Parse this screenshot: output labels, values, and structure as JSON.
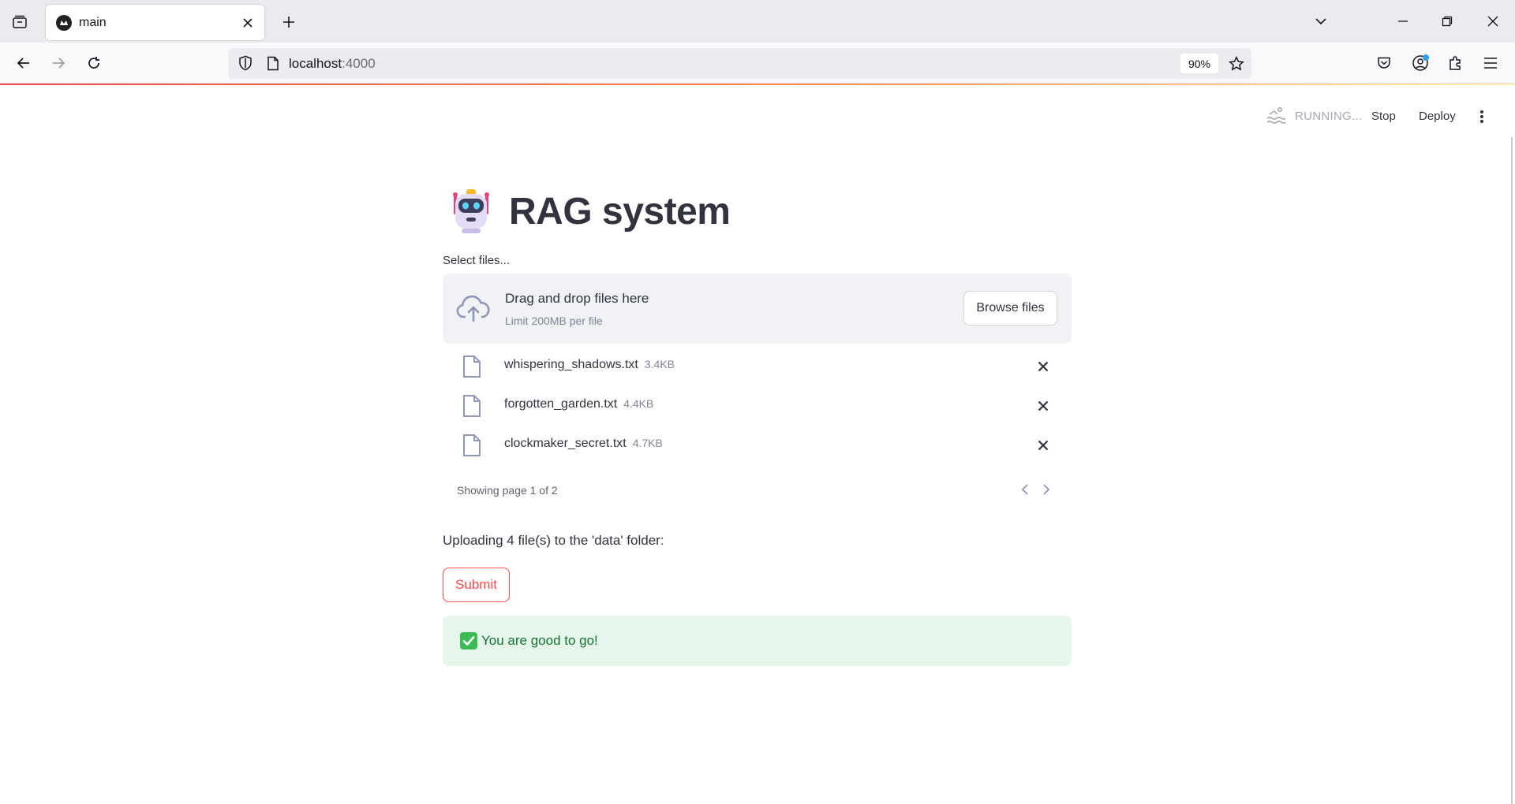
{
  "browser": {
    "tab_title": "main",
    "url_host": "localhost",
    "url_port": ":4000",
    "zoom": "90%"
  },
  "app_header": {
    "status": "RUNNING...",
    "stop_label": "Stop",
    "deploy_label": "Deploy"
  },
  "page": {
    "title": "RAG system",
    "uploader_label": "Select files...",
    "dropzone_title": "Drag and drop files here",
    "dropzone_limit": "Limit 200MB per file",
    "browse_label": "Browse files",
    "files": [
      {
        "name": "whispering_shadows.txt",
        "size": "3.4KB"
      },
      {
        "name": "forgotten_garden.txt",
        "size": "4.4KB"
      },
      {
        "name": "clockmaker_secret.txt",
        "size": "4.7KB"
      }
    ],
    "pagination": "Showing page 1 of 2",
    "upload_info": "Uploading 4 file(s) to the 'data' folder:",
    "submit_label": "Submit",
    "success_message": "You are good to go!"
  },
  "colors": {
    "accent": "#ff4b4b",
    "success_bg": "#e5f6ea",
    "success_text": "#177233",
    "dropzone_bg": "#f0f2f6"
  }
}
